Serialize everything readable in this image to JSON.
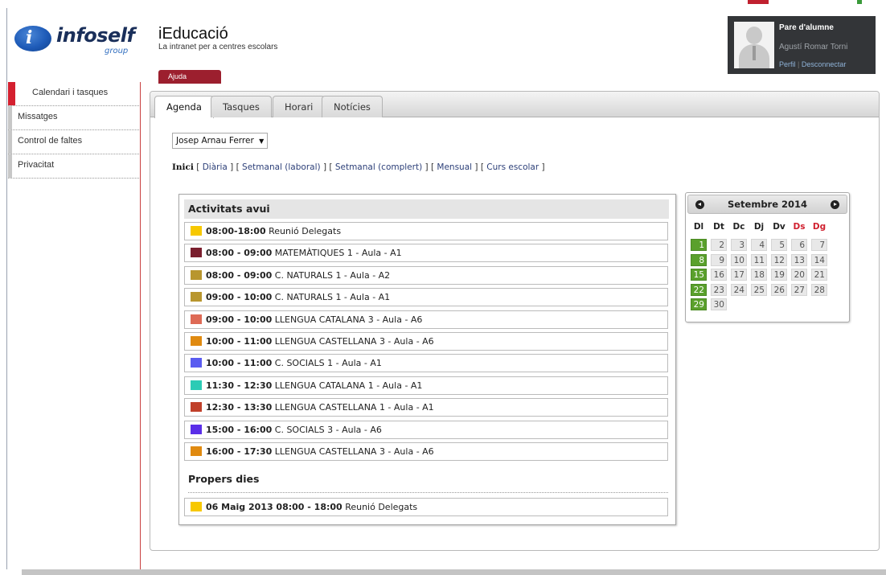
{
  "header": {
    "logo_brand": "infoself",
    "logo_sub": "group",
    "logo_letter": "i",
    "app_title": "iEducació",
    "app_subtitle": "La intranet per a centres escolars",
    "help_button": "Ajuda"
  },
  "user": {
    "role": "Pare d'alumne",
    "name": "Agustí Romar Torni",
    "profile_link": "Perfil",
    "separator": "|",
    "logout_link": "Desconnectar"
  },
  "sidebar": {
    "items": [
      {
        "label": "Calendari i tasques",
        "active": true
      },
      {
        "label": "Missatges",
        "active": false
      },
      {
        "label": "Control de faltes",
        "active": false
      },
      {
        "label": "Privacitat",
        "active": false
      }
    ]
  },
  "tabs": [
    {
      "label": "Agenda",
      "active": true
    },
    {
      "label": "Tasques",
      "active": false
    },
    {
      "label": "Horari",
      "active": false
    },
    {
      "label": "Notícies",
      "active": false
    }
  ],
  "student_select": {
    "value": "Josep Arnau Ferrer",
    "arrow": "▼"
  },
  "views": {
    "current": "Inici",
    "open": "[",
    "close": "]",
    "sep": "] [",
    "links": [
      "Diària",
      "Setmanal (laboral)",
      "Setmanal (complert)",
      "Mensual",
      "Curs escolar"
    ]
  },
  "activities": {
    "today_heading": "Activitats avui",
    "today": [
      {
        "time": "08:00-18:00",
        "text": "Reunió Delegats",
        "color": "#f7c800"
      },
      {
        "time": "08:00 - 09:00",
        "text": "MATEMÀTIQUES 1 - Aula - A1",
        "color": "#7a1f2e"
      },
      {
        "time": "08:00 - 09:00",
        "text": "C. NATURALS 1 - Aula - A2",
        "color": "#b8962e"
      },
      {
        "time": "09:00 - 10:00",
        "text": "C. NATURALS 1 - Aula - A1",
        "color": "#b8962e"
      },
      {
        "time": "09:00 - 10:00",
        "text": "LLENGUA CATALANA 3 - Aula - A6",
        "color": "#de6a55"
      },
      {
        "time": "10:00 - 11:00",
        "text": "LLENGUA CASTELLANA 3 - Aula - A6",
        "color": "#e08a10"
      },
      {
        "time": "10:00 - 11:00",
        "text": "C. SOCIALS 1 - Aula - A1",
        "color": "#5a5cf0"
      },
      {
        "time": "11:30 - 12:30",
        "text": "LLENGUA CATALANA 1 - Aula - A1",
        "color": "#2ccbb5"
      },
      {
        "time": "12:30 - 13:30",
        "text": "LLENGUA CASTELLANA 1 - Aula - A1",
        "color": "#c0402a"
      },
      {
        "time": "15:00 - 16:00",
        "text": "C. SOCIALS 3 - Aula - A6",
        "color": "#5a2ee8"
      },
      {
        "time": "16:00 - 17:30",
        "text": "LLENGUA CASTELLANA 3 - Aula - A6",
        "color": "#e08a10"
      }
    ],
    "next_heading": "Propers dies",
    "next": [
      {
        "time": "06 Maig 2013 08:00 - 18:00",
        "text": "Reunió Delegats",
        "color": "#f7c800"
      }
    ]
  },
  "calendar": {
    "title": "Setembre 2014",
    "prev_icon": "prev-circle-icon",
    "next_icon": "next-circle-icon",
    "weekdays": [
      "Dl",
      "Dt",
      "Dc",
      "Dj",
      "Dv",
      "Ds",
      "Dg"
    ],
    "weekend_color": "#d0202f",
    "weeks": [
      [
        1,
        2,
        3,
        4,
        5,
        6,
        7
      ],
      [
        8,
        9,
        10,
        11,
        12,
        13,
        14
      ],
      [
        15,
        16,
        17,
        18,
        19,
        20,
        21
      ],
      [
        22,
        23,
        24,
        25,
        26,
        27,
        28
      ],
      [
        29,
        30
      ]
    ]
  }
}
